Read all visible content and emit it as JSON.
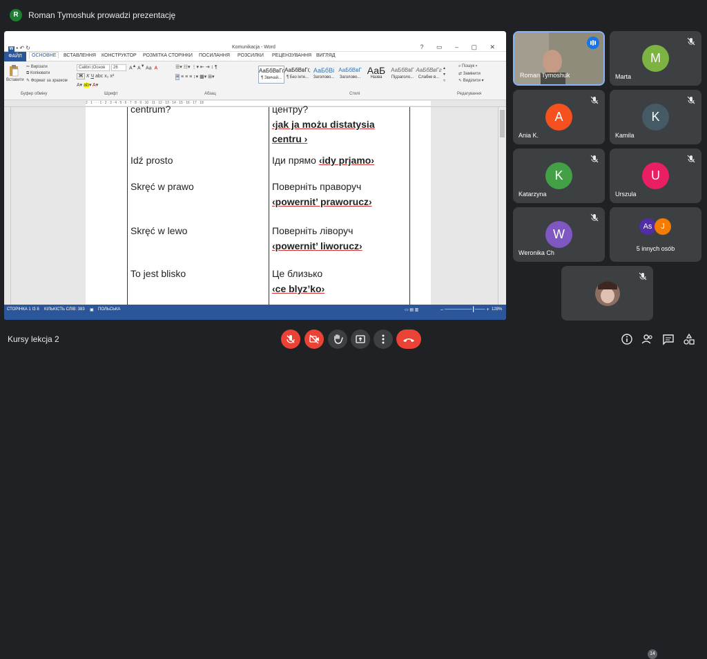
{
  "presenter": {
    "initial": "R",
    "text": "Roman Tymoshuk prowadzi prezentację"
  },
  "word": {
    "title": "Komunikacja - Word",
    "window_controls": "? ▭ – ▢ ✕",
    "tabs": [
      "ФАЙЛ",
      "ОСНОВНЕ",
      "ВСТАВЛЕННЯ",
      "КОНСТРУКТОР",
      "РОЗМІТКА СТОРІНКИ",
      "ПОСИЛАННЯ",
      "РОЗСИЛКИ",
      "РЕЦЕНЗУВАННЯ",
      "ВИГЛЯД"
    ],
    "clipboard": {
      "paste": "Вставити",
      "cut": "Вирізати",
      "copy": "Копіювати",
      "format": "Формат за зразком",
      "group": "Буфер обміну"
    },
    "font": {
      "name": "Calibri (Основ",
      "size": "26",
      "group": "Шрифт"
    },
    "paragraph_group": "Абзац",
    "styles": [
      {
        "preview": "АаБбВвГг,",
        "label": "¶ Звичай..."
      },
      {
        "preview": "АаБбВвГг,",
        "label": "¶ Без інте..."
      },
      {
        "preview": "АаБбВі",
        "label": "Заголово..."
      },
      {
        "preview": "АаБбВвГ",
        "label": "Заголово..."
      },
      {
        "preview": "АаБ",
        "label": "Назва"
      },
      {
        "preview": "АаБбВвГ",
        "label": "Підзаголо..."
      },
      {
        "preview": "АаБбВвГг",
        "label": "Слабке в..."
      }
    ],
    "styles_group": "Стилі",
    "editing": {
      "find": "Пошук",
      "replace": "Замінити",
      "select": "Виділити",
      "group": "Редагування"
    },
    "ruler_marks": "2 · 1 · · · 1 · 2 · 3 · 4 · 5 · 6 · 7 · 8 · 9 · 10 · 11 · 12 · 13 · 14 · 15 · 16 · 17 · 18",
    "rows": [
      {
        "pl": "centrum?",
        "ua": "центру?",
        "tr1": "‹jak ja możu distatysia",
        "tr2": "centru ›"
      },
      {
        "pl": "Idź prosto",
        "ua": "Іди прямо",
        "tr1": "‹idy prjamo›"
      },
      {
        "pl": "Skręć w prawo",
        "ua": "Поверніть праворуч",
        "tr1": "‹powernit’ praworucz›"
      },
      {
        "pl": "Skręć w lewo",
        "ua": "Поверніть ліворуч",
        "tr1": "‹powernit’ liworucz›"
      },
      {
        "pl": "To jest blisko",
        "ua": "Це близько",
        "tr1": "‹ce blyz’ko›"
      }
    ],
    "status": {
      "page": "СТОРІНКА 1 ІЗ 8",
      "words": "КІЛЬКІСТЬ СЛІВ: 383",
      "lang": "ПОЛЬСЬКА",
      "zoom": "128%"
    }
  },
  "participants": [
    {
      "name": "Roman Tymoshuk",
      "initial": "",
      "color": "#6b6f5a",
      "video": true,
      "speaking": true
    },
    {
      "name": "Marta",
      "initial": "M",
      "color": "#7cb342"
    },
    {
      "name": "Ania K.",
      "initial": "A",
      "color": "#f4511e"
    },
    {
      "name": "Kamila",
      "initial": "K",
      "color": "#455a64"
    },
    {
      "name": "Katarzyna",
      "initial": "K",
      "color": "#43a047"
    },
    {
      "name": "Urszula",
      "initial": "U",
      "color": "#e91e63"
    },
    {
      "name": "Weronika Ch",
      "initial": "W",
      "color": "#7e57c2"
    },
    {
      "name": "5 innych osób",
      "initial": "As",
      "initial2": "J",
      "color": "#512da8",
      "color2": "#f57c00"
    },
    {
      "name": "",
      "initial": "",
      "color": "#5d4037"
    }
  ],
  "bottom": {
    "meeting_title": "Kursy lekcja 2",
    "people_count": "14"
  },
  "colors": {
    "bg": "#202124",
    "tile": "#3c4043",
    "red": "#ea4335",
    "word_blue": "#2b579a"
  }
}
